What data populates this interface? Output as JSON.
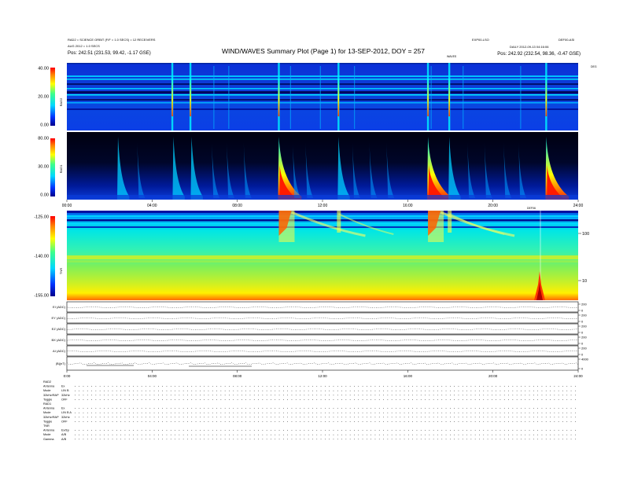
{
  "header": {
    "title": "WIND/WAVES Summary Plot (Page 1) for 13-SEP-2012, DOY = 257",
    "left_line1": "RAD2 = SCIENCE ORBIT (F/F = 1.0 SECS) = 12 RECEIVERS",
    "left_line2": "AUG 2012 = 1.0 SECS",
    "left_line3": "Pos:  242.51 (231.53, 99.42, -1.17 GSE)",
    "right_line1": "EXP00-LSO",
    "right_line2": "DAILY  2012-09-13 04:16:06",
    "right_line3": "Pos:  242.92 (232.54, 98.36, -0.47 GSE)",
    "center_small": "WAVES",
    "corner_small": "DEF00-ASI",
    "deg_small": "DEG"
  },
  "panels": {
    "rad2": {
      "label": "RAD2"
    },
    "rad1": {
      "label": "RAD1"
    },
    "tnr": {
      "label": "TNR"
    }
  },
  "chart_data": [
    {
      "type": "heatmap",
      "name": "RAD2",
      "ylabel": "RAD2",
      "yticks": [
        "40.00",
        "20.00",
        "0.00"
      ],
      "colorbar_range": [
        0,
        40
      ],
      "x_range_hours": [
        0,
        24
      ],
      "bursts_hours": [
        4.95,
        5.8,
        9.95,
        12.75,
        16.95,
        17.95,
        22.5
      ]
    },
    {
      "type": "heatmap",
      "name": "RAD1",
      "ylabel": "RAD1",
      "yticks": [
        "80.00",
        "30.00",
        "0.00"
      ],
      "colorbar_range": [
        0,
        80
      ],
      "x_range_hours": [
        0,
        24
      ],
      "xticks": [
        "00:00",
        "04:00",
        "08:00",
        "12:00",
        "16:00",
        "20:00",
        "24:00"
      ],
      "bursts_hours": [
        2.4,
        5.0,
        5.85,
        9.95,
        12.75,
        16.95,
        17.95,
        22.5
      ]
    },
    {
      "type": "heatmap",
      "name": "TNR",
      "ylabel": "TNR",
      "yticks": [
        "-125.00",
        "-140.00",
        "-155.00"
      ],
      "right_ticks": [
        "100",
        "10"
      ],
      "colorbar_range": [
        -155,
        -125
      ],
      "x_range_hours": [
        0,
        24
      ],
      "marker_label": "DEF06",
      "marker_hours": 22.0
    },
    {
      "type": "line",
      "name": "Housekeeping traces",
      "rows": [
        {
          "label": "EI (ADC)",
          "right_ticks": [
            "200",
            "0"
          ]
        },
        {
          "label": "EY (ADC)",
          "right_ticks": [
            "200",
            "0"
          ]
        },
        {
          "label": "EZ (ADC)",
          "right_ticks": [
            "200",
            "0"
          ]
        },
        {
          "label": "BX (ADC)",
          "right_ticks": [
            "200",
            "0"
          ]
        },
        {
          "label": "AI (ADC)",
          "right_ticks": [
            "200",
            "0"
          ]
        },
        {
          "label": "|B|(nT)",
          "right_ticks": [
            "4000",
            "0"
          ]
        }
      ],
      "xticks": [
        "0:00",
        "04:00",
        "08:00",
        "12:00",
        "16:00",
        "20:00",
        "24:00"
      ]
    }
  ],
  "footer": {
    "rows": [
      {
        "label": "RAD2",
        "value": ""
      },
      {
        "label": "Antenna",
        "value": "Ex"
      },
      {
        "label": "Mode",
        "value": "LIN B"
      },
      {
        "label": "32kHz/RAP",
        "value": "32kHz"
      },
      {
        "label": "Toggle",
        "value": "OFF"
      },
      {
        "label": "RAD1",
        "value": ""
      },
      {
        "label": "Antenna",
        "value": "Ex"
      },
      {
        "label": "Mode",
        "value": "LIN B A"
      },
      {
        "label": "32kHz/RAP",
        "value": "32kHz"
      },
      {
        "label": "Toggle",
        "value": "OFF"
      },
      {
        "label": "TNR",
        "value": ""
      },
      {
        "label": "Antenna",
        "value": "Ex/Ey"
      },
      {
        "label": "Mode",
        "value": "A/B"
      },
      {
        "label": "Gamma",
        "value": "A/B"
      }
    ]
  }
}
